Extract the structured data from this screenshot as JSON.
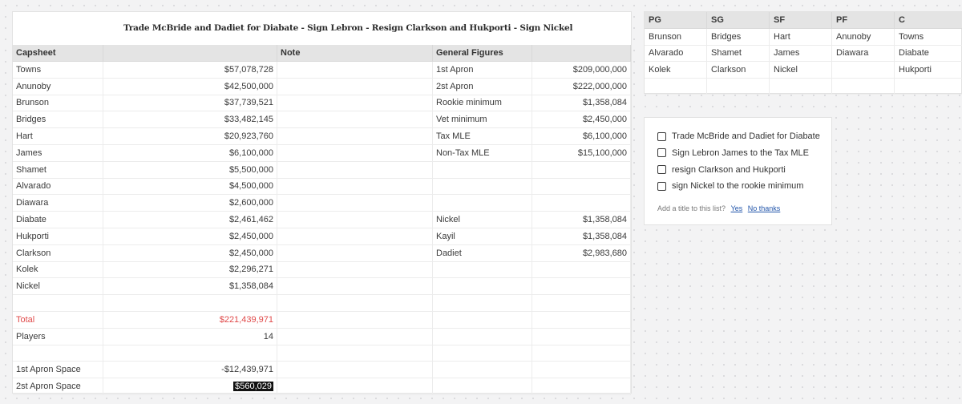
{
  "sheet": {
    "title": "Trade McBride and Dadiet for Diabate - Sign Lebron - Resign Clarkson and Hukporti - Sign Nickel",
    "headers": [
      "Capsheet",
      "",
      "Note",
      "General Figures",
      ""
    ],
    "rows": [
      [
        "Towns",
        "$57,078,728",
        "",
        "1st Apron",
        "$209,000,000"
      ],
      [
        "Anunoby",
        "$42,500,000",
        "",
        "2st Apron",
        "$222,000,000"
      ],
      [
        "Brunson",
        "$37,739,521",
        "",
        "Rookie minimum",
        "$1,358,084"
      ],
      [
        "Bridges",
        "$33,482,145",
        "",
        "Vet minimum",
        "$2,450,000"
      ],
      [
        "Hart",
        "$20,923,760",
        "",
        "Tax MLE",
        "$6,100,000"
      ],
      [
        "James",
        "$6,100,000",
        "",
        "Non-Tax MLE",
        "$15,100,000"
      ],
      [
        "Shamet",
        "$5,500,000",
        "",
        "",
        ""
      ],
      [
        "Alvarado",
        "$4,500,000",
        "",
        "",
        ""
      ],
      [
        "Diawara",
        "$2,600,000",
        "",
        "",
        ""
      ],
      [
        "Diabate",
        "$2,461,462",
        "",
        "Nickel",
        "$1,358,084"
      ],
      [
        "Hukporti",
        "$2,450,000",
        "",
        "Kayil",
        "$1,358,084"
      ],
      [
        "Clarkson",
        "$2,450,000",
        "",
        "Dadiet",
        "$2,983,680"
      ],
      [
        "Kolek",
        "$2,296,271",
        "",
        "",
        ""
      ],
      [
        "Nickel",
        "$1,358,084",
        "",
        "",
        ""
      ],
      [
        "",
        "",
        "",
        "",
        ""
      ],
      [
        "Total",
        "$221,439,971",
        "",
        "",
        ""
      ],
      [
        "Players",
        "14",
        "",
        "",
        ""
      ],
      [
        "",
        "",
        "",
        "",
        ""
      ],
      [
        "1st Apron Space",
        "-$12,439,971",
        "",
        "",
        ""
      ],
      [
        "2st Apron Space",
        "$560,029",
        "",
        "",
        ""
      ]
    ],
    "colors": {
      "total": "#e04a4a",
      "highlight_bg": "#111111"
    }
  },
  "positions": {
    "headers": [
      "PG",
      "SG",
      "SF",
      "PF",
      "C"
    ],
    "rows": [
      [
        "Brunson",
        "Bridges",
        "Hart",
        "Anunoby",
        "Towns"
      ],
      [
        "Alvarado",
        "Shamet",
        "James",
        "Diawara",
        "Diabate"
      ],
      [
        "Kolek",
        "Clarkson",
        "Nickel",
        "",
        "Hukporti"
      ],
      [
        "",
        "",
        "",
        "",
        ""
      ]
    ]
  },
  "checklist": {
    "items": [
      "Trade McBride and Dadiet for Diabate",
      "Sign Lebron James to the Tax MLE",
      "resign Clarkson and Hukporti",
      "sign Nickel to the rookie minimum"
    ],
    "prompt": "Add a title to this list?",
    "yes": "Yes",
    "no": "No thanks"
  }
}
